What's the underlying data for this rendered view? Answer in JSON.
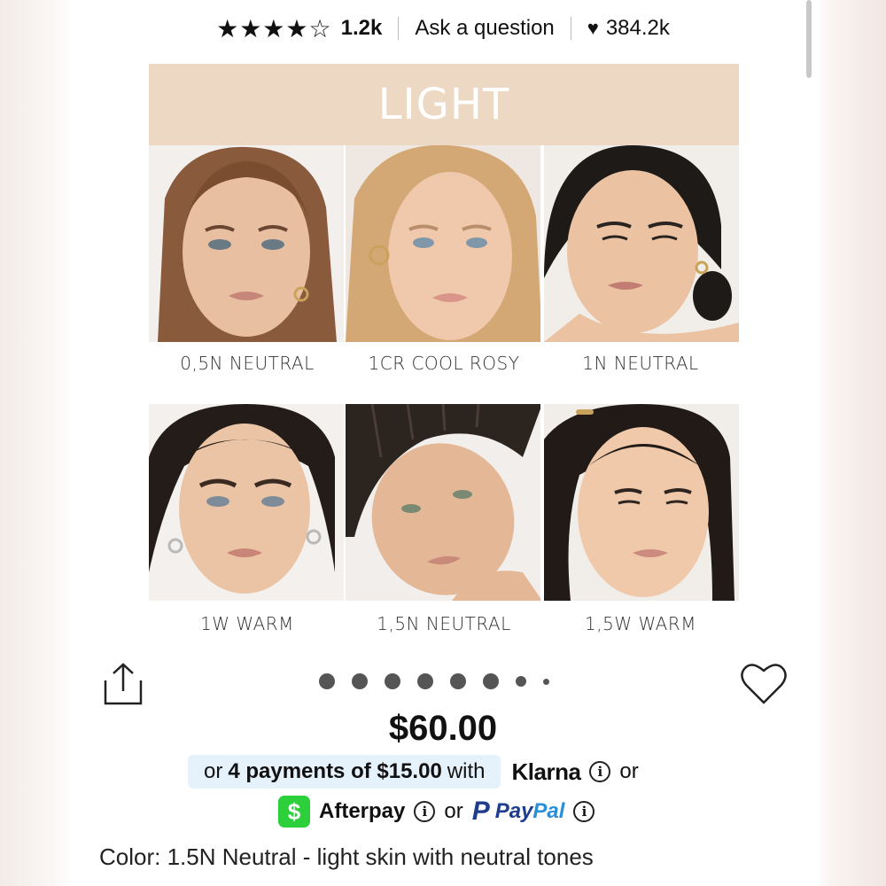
{
  "rating": {
    "stars": "★★★★☆",
    "count": "1.2k"
  },
  "ask_question": "Ask a question",
  "loves": {
    "icon": "heart-icon",
    "count": "384.2k"
  },
  "image": {
    "banner": "LIGHT",
    "captions": [
      "0,5N NEUTRAL",
      "1CR COOL ROSY",
      "1N NEUTRAL",
      "1W WARM",
      "1,5N NEUTRAL",
      "1,5W WARM"
    ]
  },
  "carousel": {
    "total_dots": 8
  },
  "price": "$60.00",
  "klarna": {
    "prefix": "or",
    "bold": "4 payments of $15.00",
    "suffix": "with",
    "brand": "Klarna",
    "after": "or"
  },
  "afterpay": {
    "badge": "$",
    "brand": "Afterpay",
    "or": "or"
  },
  "paypal": {
    "p": "P",
    "pay": "Pay",
    "pal": "Pal"
  },
  "color_line": "Color: 1.5N Neutral - light skin with neutral tones"
}
